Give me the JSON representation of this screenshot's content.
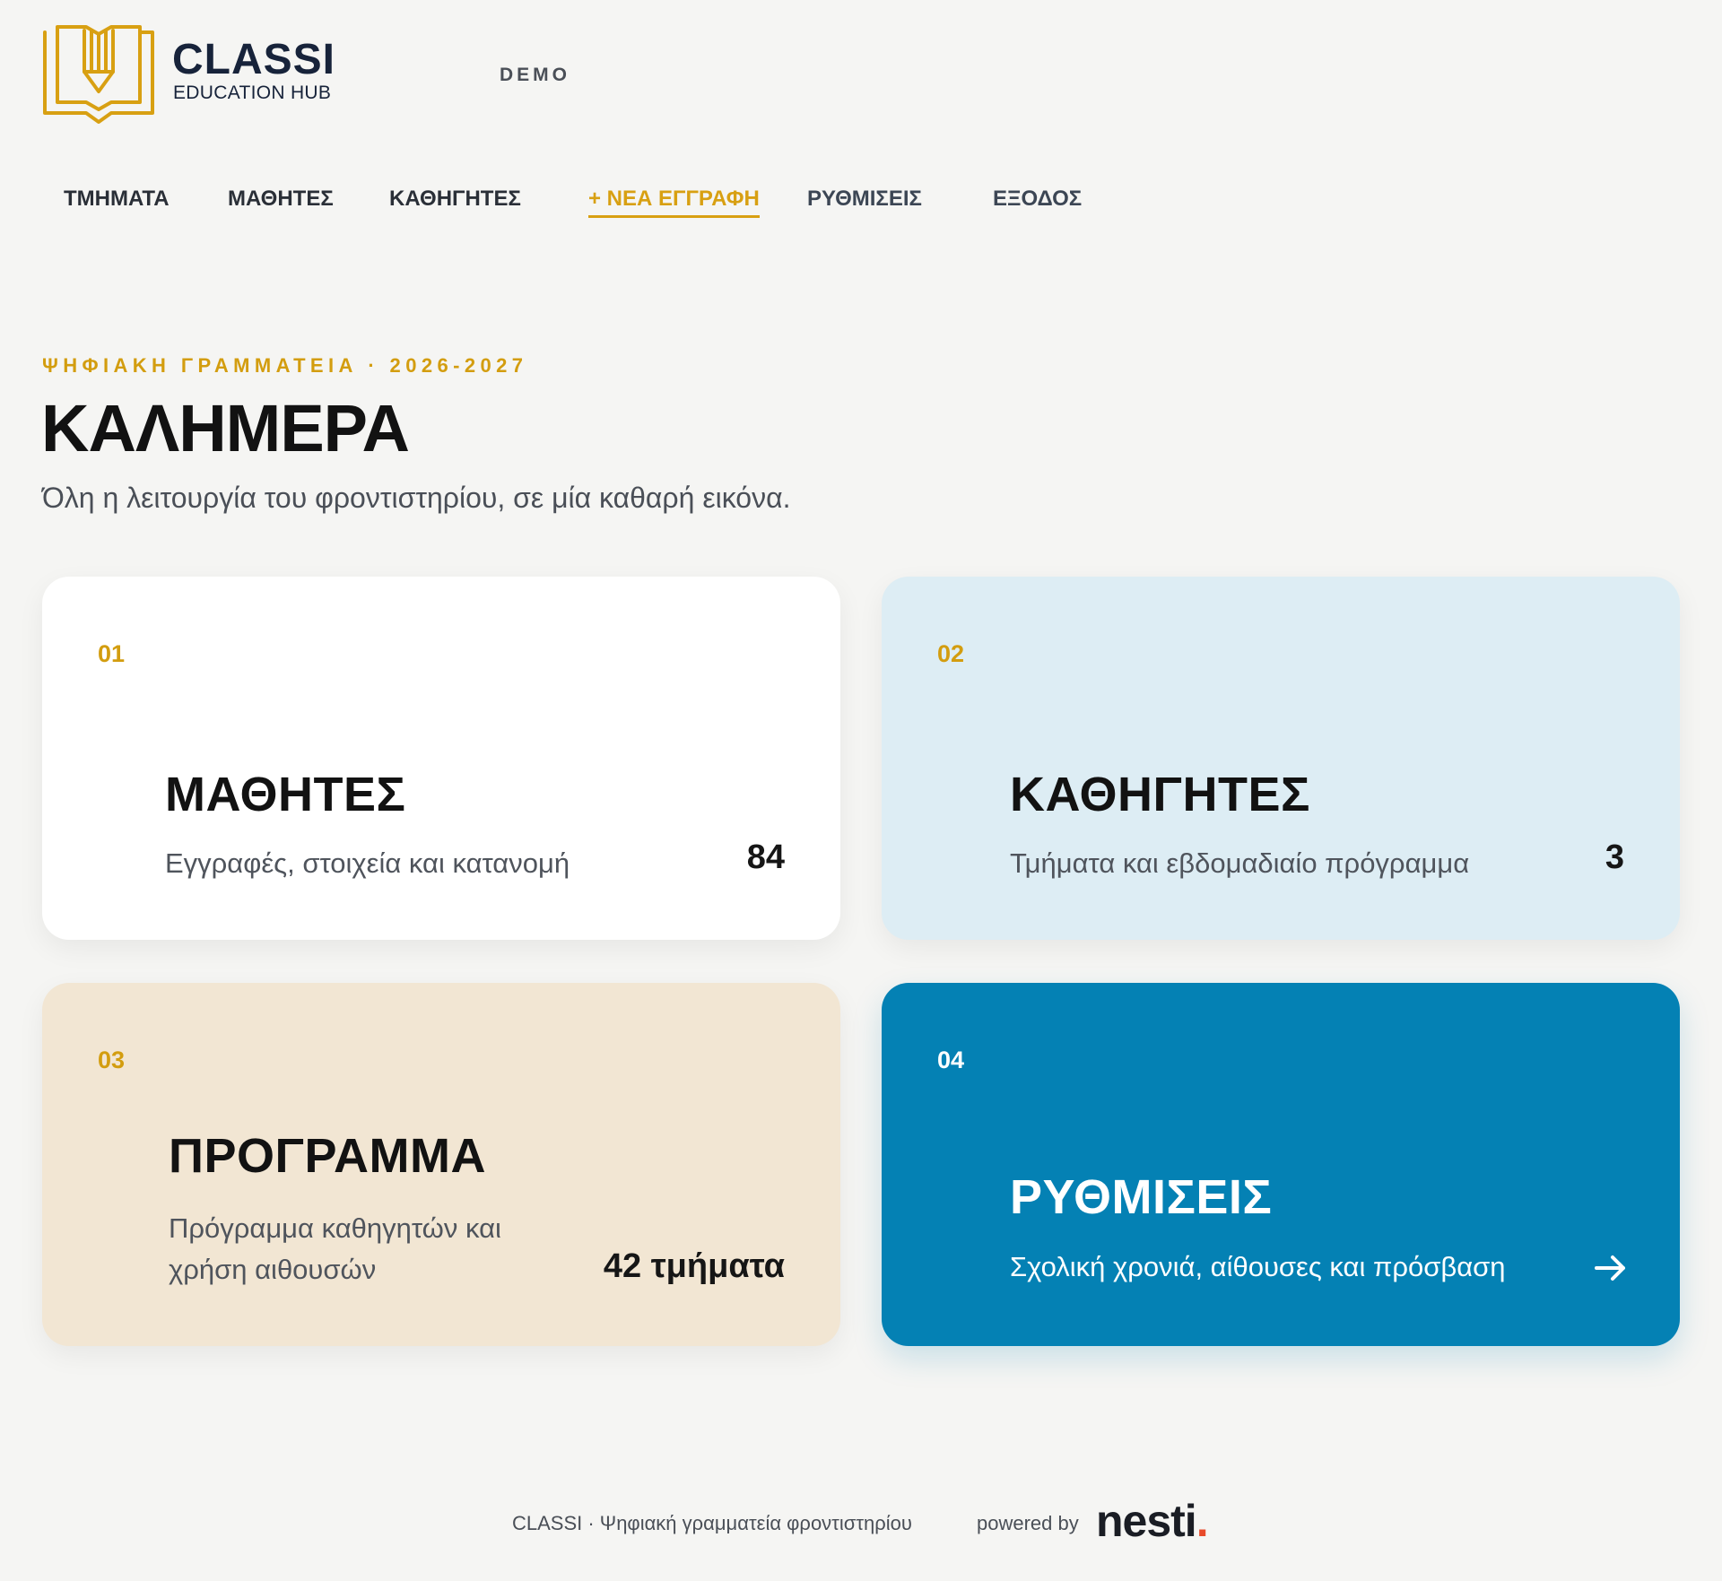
{
  "brand": {
    "name": "CLASSI",
    "subtitle": "EDUCATION HUB",
    "tag": "DEMO",
    "logo_icon": "book-pencil-icon",
    "color": "#d8a012"
  },
  "nav": {
    "items": [
      {
        "label": "ΤΜΗΜΑΤΑ"
      },
      {
        "label": "ΜΑΘΗΤΕΣ"
      },
      {
        "label": "ΚΑΘΗΓΗΤΕΣ"
      },
      {
        "label": "+ ΝΕΑ ΕΓΓΡΑΦΗ",
        "active": true
      },
      {
        "label": "ΡΥΘΜΙΣΕΙΣ"
      },
      {
        "label": "ΕΞΟΔΟΣ"
      }
    ]
  },
  "hero": {
    "eyebrow": "ΨΗΦΙΑΚΗ ΓΡΑΜΜΑΤΕΙΑ · 2026-2027",
    "title": "ΚΑΛΗΜΕΡΑ",
    "subtitle": "Όλη η λειτουργία του φροντιστηρίου, σε μία καθαρή εικόνα."
  },
  "cards": [
    {
      "num": "01",
      "title": "ΜΑΘΗΤΕΣ",
      "desc": "Εγγραφές, στοιχεία και κατανομή",
      "metric": "84",
      "bg": "#ffffff"
    },
    {
      "num": "02",
      "title": "ΚΑΘΗΓΗΤΕΣ",
      "desc": "Τμήματα και εβδομαδιαίο πρόγραμμα",
      "metric": "3",
      "bg": "#ddedf4"
    },
    {
      "num": "03",
      "title": "ΠΡΟΓΡΑΜΜΑ",
      "desc": "Πρόγραμμα καθηγητών και χρήση αιθουσών",
      "metric": "42 τμήματα",
      "bg": "#f2e6d3"
    },
    {
      "num": "04",
      "title": "ΡΥΘΜΙΣΕΙΣ",
      "desc": "Σχολική χρονιά, αίθουσες και πρόσβαση",
      "icon": "arrow-right-icon",
      "bg": "#0481b4"
    }
  ],
  "footer": {
    "text": "CLASSI · Ψηφιακή γραμματεία φροντιστηρίου",
    "powered_by": "powered by",
    "vendor": "nesti",
    "vendor_dot": ".",
    "accent": "#e84a2a"
  },
  "colors": {
    "accent": "#d8a012",
    "primary_blue": "#0481b4",
    "background": "#f5f5f3"
  }
}
